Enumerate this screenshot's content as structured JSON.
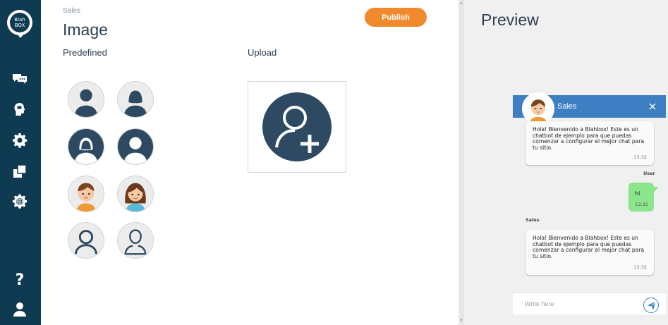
{
  "sidebar": {
    "logo_line1": "Blah",
    "logo_line2": "BOX",
    "items": [
      {
        "icon": "chat-bubbles-icon"
      },
      {
        "icon": "head-bubble-icon"
      },
      {
        "icon": "gear-icon"
      },
      {
        "icon": "squares-icon"
      },
      {
        "icon": "globe-gear-icon"
      },
      {
        "icon": "help-icon"
      },
      {
        "icon": "user-icon"
      }
    ],
    "bg_color": "#0e3a52"
  },
  "main": {
    "breadcrumb": "Sales",
    "title": "Image",
    "publish_label": "Publish",
    "predefined_label": "Predefined",
    "upload_label": "Upload",
    "accent_color": "#f18a2c"
  },
  "preview": {
    "title": "Preview",
    "bot_name": "Sales",
    "header_color": "#3d7fc2",
    "messages": [
      {
        "from": "bot",
        "text": "Hola! Bienvenido a Blahbox! Este es un chatbot de ejemplo para que puedas comenzar a configurar el mejor chat para tu sitio.",
        "time": "13:32"
      },
      {
        "from": "user",
        "sender_label": "User",
        "text": "hi",
        "time": "13:32"
      },
      {
        "from": "bot",
        "sender_label": "Sales",
        "text": "Hola! Bienvenido a Blahbox! Este es un chatbot de ejemplo para que puedas comenzar a configurar el mejor chat para tu sitio.",
        "time": "13:32"
      }
    ],
    "input_placeholder": "Write here"
  }
}
